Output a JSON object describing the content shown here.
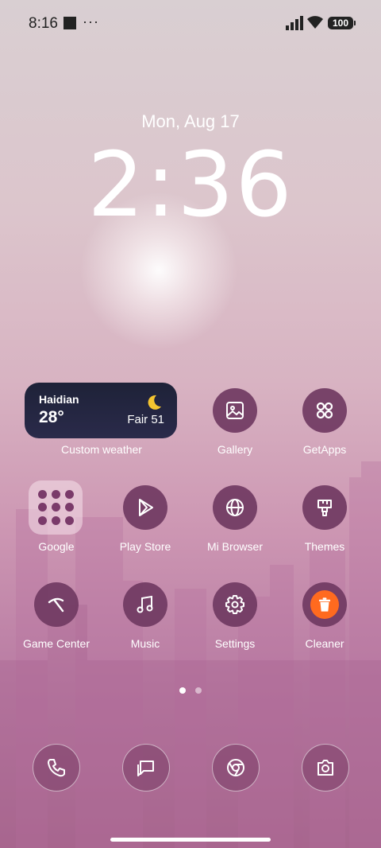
{
  "status_bar": {
    "time": "8:16",
    "overflow": "···",
    "battery": "100"
  },
  "lockscreen": {
    "date": "Mon, Aug 17",
    "time": "2:36"
  },
  "weather_widget": {
    "city": "Haidian",
    "temperature": "28°",
    "condition": "Fair 51",
    "label": "Custom weather"
  },
  "apps": [
    {
      "name": "Gallery",
      "icon": "image-icon"
    },
    {
      "name": "GetApps",
      "icon": "grid-icon"
    },
    {
      "name": "Google",
      "icon": "folder-icon"
    },
    {
      "name": "Play Store",
      "icon": "play-icon"
    },
    {
      "name": "Mi Browser",
      "icon": "globe-icon"
    },
    {
      "name": "Themes",
      "icon": "brush-icon"
    },
    {
      "name": "Game Center",
      "icon": "boomerang-icon"
    },
    {
      "name": "Music",
      "icon": "music-note-icon"
    },
    {
      "name": "Settings",
      "icon": "gear-icon"
    },
    {
      "name": "Cleaner",
      "icon": "trash-icon"
    }
  ],
  "page_indicator": {
    "pages": 2,
    "active": 1
  },
  "dock": [
    {
      "icon": "phone-icon"
    },
    {
      "icon": "message-icon"
    },
    {
      "icon": "chrome-icon"
    },
    {
      "icon": "camera-icon"
    }
  ],
  "colors": {
    "icon_bg": "#703a62",
    "cleaner_accent": "#ff6a1f",
    "weather_bg": "#1e2238"
  }
}
